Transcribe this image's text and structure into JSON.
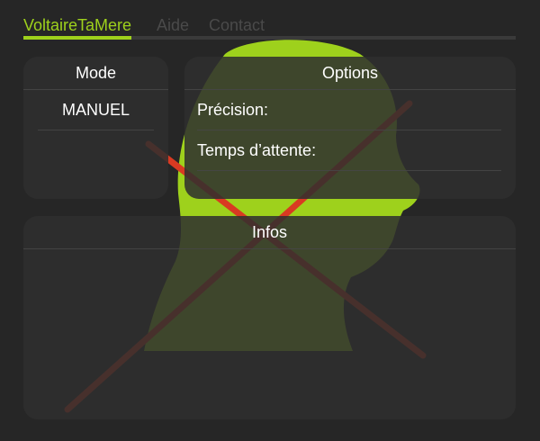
{
  "tabs": [
    {
      "label": "VoltaireTaMere",
      "active": true
    },
    {
      "label": "Aide",
      "active": false
    },
    {
      "label": "Contact",
      "active": false
    }
  ],
  "mode_panel": {
    "title": "Mode",
    "value": "MANUEL"
  },
  "options_panel": {
    "title": "Options",
    "precision_label": "Précision:",
    "wait_label": "Temps d’attente:"
  },
  "infos_panel": {
    "title": "Infos"
  },
  "colors": {
    "accent": "#9ed11c",
    "background": "#262626",
    "panel": "#2e2e2e",
    "cross": "#d93a22"
  },
  "background_art": "crossed-out-head-silhouette"
}
